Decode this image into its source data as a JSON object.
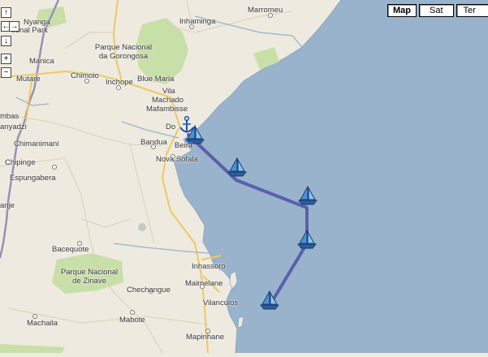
{
  "map_controls": {
    "pan_up": "↑",
    "pan_left": "←",
    "pan_right": "→",
    "pan_down": "↓",
    "zoom_in": "+",
    "zoom_out": "−"
  },
  "map_types": [
    "Map",
    "Sat",
    "Ter"
  ],
  "active_map_type": "Map",
  "places": {
    "nyanga": "Nyanga",
    "nyanga_park": "tional Park",
    "inhaminga": "Inhaminga",
    "marromeu": "Marromeu",
    "parque_gorongosa": "Parque Nacional",
    "gorongosa": "da Gorongosa",
    "manica": "Manica",
    "mutare": "Mutare",
    "chimoio": "Chimoio",
    "inchope": "Inchope",
    "blue_maria": "Blue Maria",
    "vila": "Vila",
    "machado": "Machado",
    "mafambisse": "Mafambisse",
    "dondo": "Do",
    "beira": "Beira",
    "bandua": "Bandua",
    "nova_sofala": "Nova Sofala",
    "mbas": "mbas",
    "anyadzi": "anyadzi",
    "chimanimani": "Chimanimani",
    "chipinge": "Chipinge",
    "espungabera": "Espungabera",
    "anje": "anje",
    "bacequote": "Bacequote",
    "parque_zinave": "Parque Nacional",
    "zinave": "de Zinave",
    "inhassoro": "Inhassoro",
    "maimelane": "Maimelane",
    "chechangue": "Chechangue",
    "vilanculos": "Vilanculos",
    "mabote": "Mabote",
    "machaila": "Machaila",
    "mapinhane": "Mapinhane"
  },
  "route": {
    "color": "#5555aa",
    "waypoint_icon": "sailboat-icon",
    "anchor_icon": "anchor-icon"
  },
  "colors": {
    "sea": "#99b3cc",
    "land": "#eeeadf",
    "park": "#c8dfa8",
    "road": "#f5d98a",
    "border": "#9b8fb8"
  }
}
